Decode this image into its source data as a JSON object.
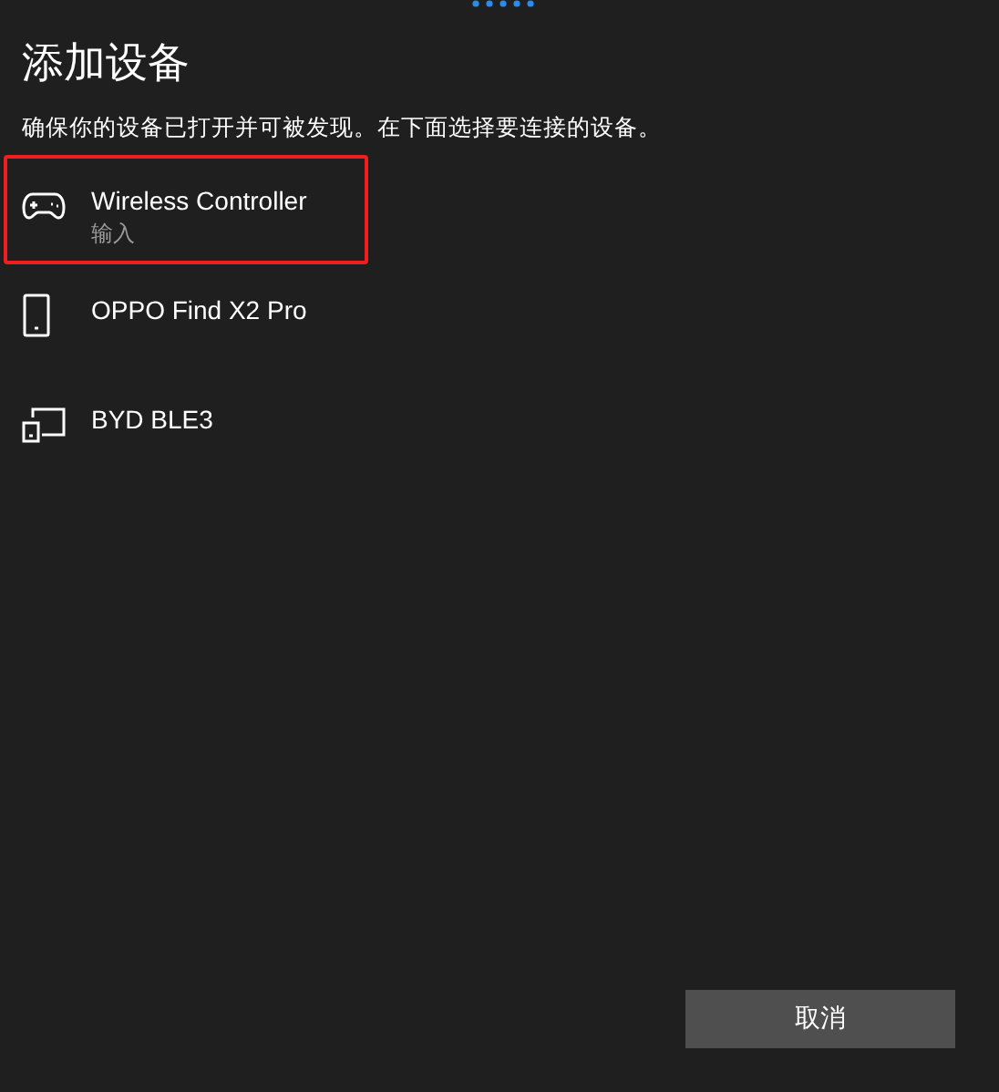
{
  "title": "添加设备",
  "instruction": "确保你的设备已打开并可被发现。在下面选择要连接的设备。",
  "devices": [
    {
      "kind": "gamepad",
      "name": "Wireless Controller",
      "subtitle": "输入",
      "highlighted": true
    },
    {
      "kind": "phone",
      "name": "OPPO Find X2 Pro",
      "highlighted": false
    },
    {
      "kind": "display",
      "name": "BYD BLE3",
      "highlighted": false
    }
  ],
  "cancel_button": "取消"
}
